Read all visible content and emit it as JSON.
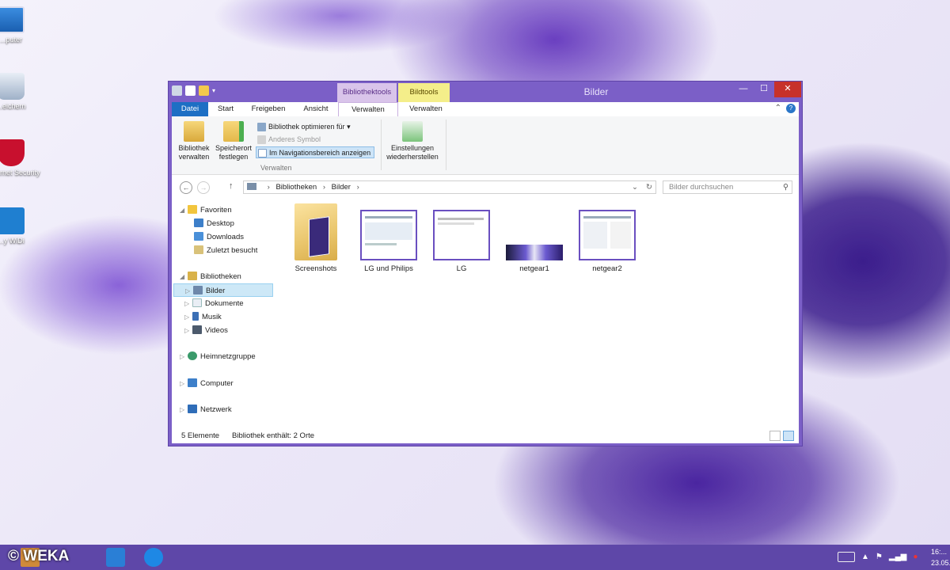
{
  "desktop": {
    "icons": [
      {
        "label": "...puter",
        "icon": "computer-icon"
      },
      {
        "label": "...eichern",
        "icon": "recycle-bin-icon"
      },
      {
        "label": "...Internet Security",
        "icon": "mcafee-icon"
      },
      {
        "label": "...y WiDi",
        "icon": "widi-icon"
      }
    ]
  },
  "window": {
    "title": "Bilder",
    "context_tabs": {
      "bibliothektools": "Bibliothektools",
      "bildtools": "Bildtools"
    },
    "tabs": {
      "datei": "Datei",
      "start": "Start",
      "freigeben": "Freigeben",
      "ansicht": "Ansicht",
      "verwalten_library": "Verwalten",
      "verwalten_picture": "Verwalten"
    },
    "ribbon": {
      "library_manage": "Bibliothek verwalten",
      "save_location": "Speicherort festlegen",
      "optimize": "Bibliothek optimieren für",
      "change_icon": "Anderes Symbol",
      "show_in_nav": "Im Navigationsbereich anzeigen",
      "group_label": "Verwalten",
      "restore_settings": "Einstellungen wiederherstellen"
    },
    "address": {
      "path": [
        "Bibliotheken",
        "Bilder"
      ],
      "search_placeholder": "Bilder durchsuchen"
    },
    "nav_pane": {
      "favorites": "Favoriten",
      "desktop": "Desktop",
      "downloads": "Downloads",
      "recent": "Zuletzt besucht",
      "libraries": "Bibliotheken",
      "pictures": "Bilder",
      "documents": "Dokumente",
      "music": "Musik",
      "videos": "Videos",
      "homegroup": "Heimnetzgruppe",
      "computer": "Computer",
      "network": "Netzwerk"
    },
    "files": [
      {
        "name": "Screenshots",
        "type": "folder"
      },
      {
        "name": "LG und Philips",
        "type": "image"
      },
      {
        "name": "LG",
        "type": "image"
      },
      {
        "name": "netgear1",
        "type": "image"
      },
      {
        "name": "netgear2",
        "type": "image"
      }
    ],
    "status": {
      "count": "5 Elemente",
      "library_info": "Bibliothek enthält: 2 Orte"
    }
  },
  "taskbar": {
    "watermark": "© WEKA",
    "clock_time": "16:...",
    "clock_date": "23.05...."
  },
  "colors": {
    "title_bar": "#7b5fc7",
    "accent": "#1d6fc4",
    "taskbar": "#5e47a8",
    "close": "#c7312a"
  }
}
